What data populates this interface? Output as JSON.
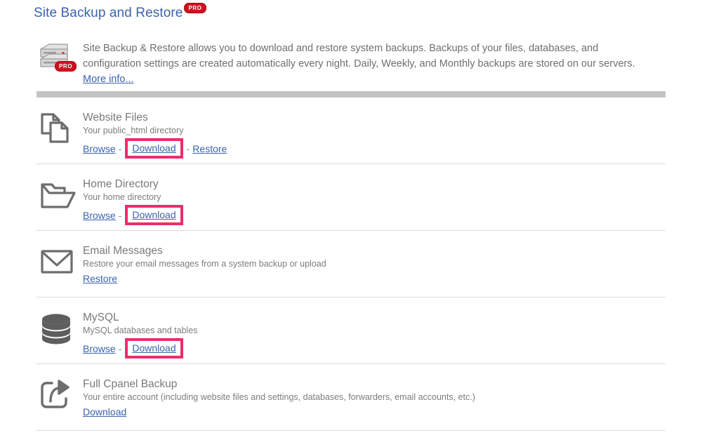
{
  "page": {
    "title": "Site Backup and Restore",
    "title_badge": "PRO"
  },
  "intro": {
    "icon": "server-stack-icon",
    "badge": "PRO",
    "line1": "Site Backup & Restore allows you to download and restore system backups. Backups of your files, databases, and",
    "line2": "configuration settings are created automatically every night. Daily, Weekly, and Monthly backups are stored on our servers.",
    "more_info_label": "More info..."
  },
  "colors": {
    "title_blue": "#3b63ae",
    "link_blue": "#3b63ae",
    "highlight_pink": "#ef2b6e",
    "badge_red": "#cf1020",
    "gray_bar": "#c3c3c3",
    "text_gray": "#6f6f6f",
    "icon_gray": "#6d6d6d"
  },
  "rows": [
    {
      "id": "website-files",
      "icon": "documents-icon",
      "title": "Website Files",
      "description": "Your public_html directory",
      "links": [
        {
          "label": "Browse",
          "highlighted": false
        },
        {
          "label": "Download",
          "highlighted": true
        },
        {
          "label": "Restore",
          "highlighted": false
        }
      ]
    },
    {
      "id": "home-directory",
      "icon": "folder-icon",
      "title": "Home Directory",
      "description": "Your home directory",
      "links": [
        {
          "label": "Browse",
          "highlighted": false
        },
        {
          "label": "Download",
          "highlighted": true
        }
      ]
    },
    {
      "id": "email-messages",
      "icon": "envelope-icon",
      "title": "Email Messages",
      "description": "Restore your email messages from a system backup or upload",
      "links": [
        {
          "label": "Restore",
          "highlighted": false
        }
      ]
    },
    {
      "id": "mysql",
      "icon": "database-icon",
      "title": "MySQL",
      "description": "MySQL databases and tables",
      "links": [
        {
          "label": "Browse",
          "highlighted": false
        },
        {
          "label": "Download",
          "highlighted": true
        }
      ]
    },
    {
      "id": "full-cpanel-backup",
      "icon": "share-export-icon",
      "title": "Full Cpanel Backup",
      "description": "Your entire account (including website files and settings, databases, forwarders, email accounts, etc.)",
      "links": [
        {
          "label": "Download",
          "highlighted": false
        }
      ]
    }
  ]
}
